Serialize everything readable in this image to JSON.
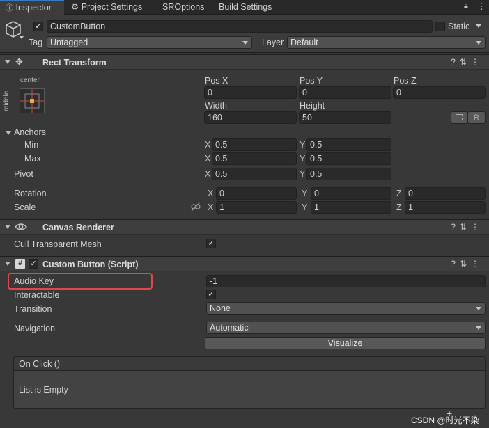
{
  "tabs": [
    {
      "label": "Inspector",
      "icon": "info-icon"
    },
    {
      "label": "Project Settings",
      "icon": "gear-icon"
    },
    {
      "label": "SROptions"
    },
    {
      "label": "Build Settings"
    }
  ],
  "object": {
    "name": "CustomButton",
    "static_label": "Static",
    "tag_label": "Tag",
    "tag_value": "Untagged",
    "layer_label": "Layer",
    "layer_value": "Default"
  },
  "rect_transform": {
    "title": "Rect Transform",
    "anchor_preset_h": "center",
    "anchor_preset_v": "middle",
    "pos_x_label": "Pos X",
    "pos_x": "0",
    "pos_y_label": "Pos Y",
    "pos_y": "0",
    "pos_z_label": "Pos Z",
    "pos_z": "0",
    "width_label": "Width",
    "width": "160",
    "height_label": "Height",
    "height": "50",
    "raw_button": "R",
    "anchors_label": "Anchors",
    "min_label": "Min",
    "min_x": "0.5",
    "min_y": "0.5",
    "max_label": "Max",
    "max_x": "0.5",
    "max_y": "0.5",
    "pivot_label": "Pivot",
    "pivot_x": "0.5",
    "pivot_y": "0.5",
    "rotation_label": "Rotation",
    "rot_x": "0",
    "rot_y": "0",
    "rot_z": "0",
    "scale_label": "Scale",
    "scale_x": "1",
    "scale_y": "1",
    "scale_z": "1",
    "axis_x": "X",
    "axis_y": "Y",
    "axis_z": "Z"
  },
  "canvas_renderer": {
    "title": "Canvas Renderer",
    "cull_label": "Cull Transparent Mesh"
  },
  "custom_button": {
    "title": "Custom Button (Script)",
    "audio_key_label": "Audio Key",
    "audio_key": "-1",
    "interactable_label": "Interactable",
    "transition_label": "Transition",
    "transition_value": "None",
    "navigation_label": "Navigation",
    "navigation_value": "Automatic",
    "visualize_button": "Visualize",
    "onclick_title": "On Click ()",
    "list_empty": "List is Empty"
  },
  "watermark": "CSDN @时光不染",
  "colors": {
    "highlight": "#e0474c",
    "active_tab_accent": "#3a79bb"
  }
}
